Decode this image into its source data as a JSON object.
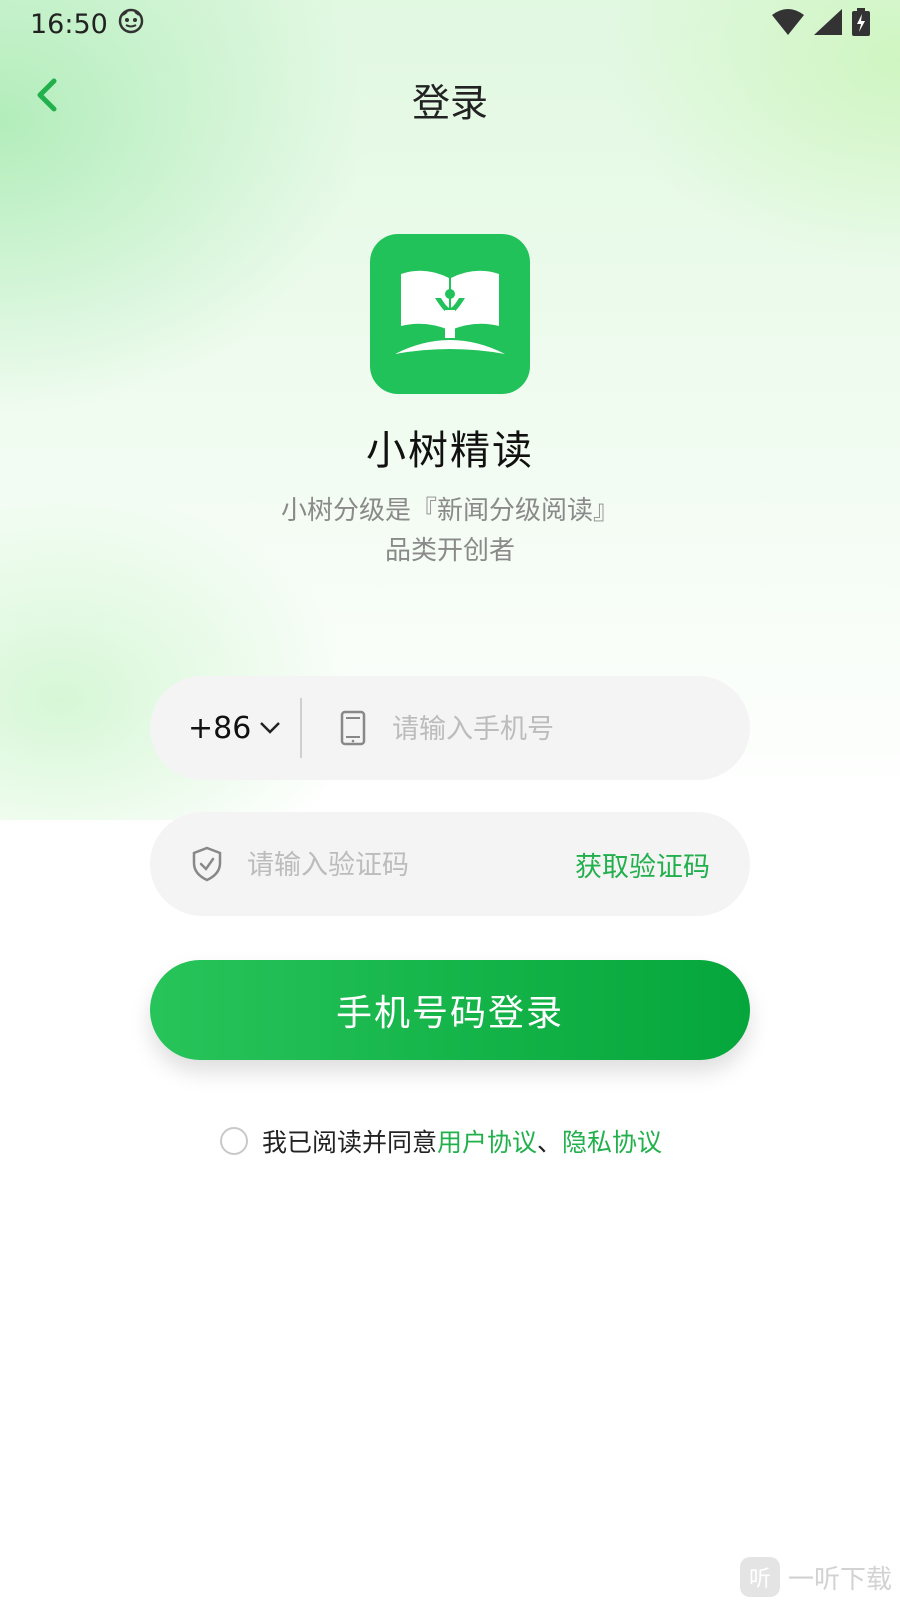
{
  "status_bar": {
    "time": "16:50"
  },
  "header": {
    "title": "登录"
  },
  "app": {
    "name": "小树精读",
    "slogan_line1": "小树分级是『新闻分级阅读』",
    "slogan_line2": "品类开创者",
    "brand_color": "#22c25a"
  },
  "phone_field": {
    "country_code": "+86",
    "placeholder": "请输入手机号"
  },
  "code_field": {
    "placeholder": "请输入验证码",
    "get_code_label": "获取验证码"
  },
  "login_button": {
    "label": "手机号码登录"
  },
  "agreement": {
    "prefix": "我已阅读并同意",
    "user_agreement": "用户协议",
    "separator": "、",
    "privacy_agreement": "隐私协议",
    "checked": false
  },
  "watermark": {
    "badge": "听",
    "text": "一听下载"
  }
}
